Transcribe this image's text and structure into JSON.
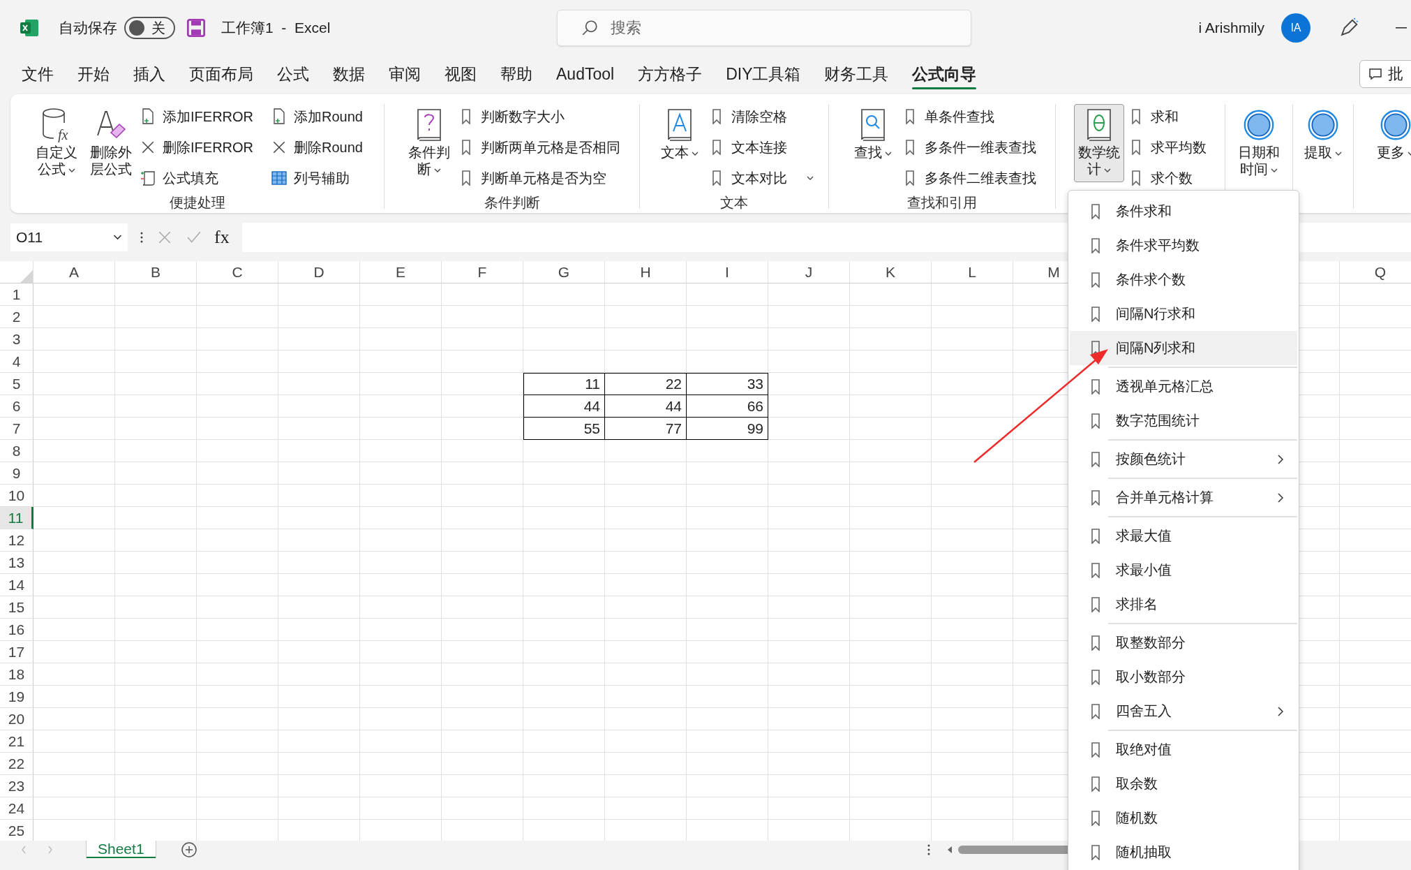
{
  "title_bar": {
    "autosave_label": "自动保存",
    "autosave": {
      "on": false,
      "label": "关"
    },
    "title": "工作簿1  -  Excel",
    "search": {
      "placeholder": "搜索"
    },
    "user_name": "i Arishmily",
    "avatar": "IA"
  },
  "tabs": [
    {
      "label": "文件",
      "selected": false
    },
    {
      "label": "开始",
      "selected": false
    },
    {
      "label": "插入",
      "selected": false
    },
    {
      "label": "页面布局",
      "selected": false
    },
    {
      "label": "公式",
      "selected": false
    },
    {
      "label": "数据",
      "selected": false
    },
    {
      "label": "审阅",
      "selected": false
    },
    {
      "label": "视图",
      "selected": false
    },
    {
      "label": "帮助",
      "selected": false
    },
    {
      "label": "AudTool",
      "selected": false
    },
    {
      "label": "方方格子",
      "selected": false
    },
    {
      "label": "DIY工具箱",
      "selected": false
    },
    {
      "label": "财务工具",
      "selected": false
    },
    {
      "label": "公式向导",
      "selected": true
    }
  ],
  "comment_button": "批",
  "ribbon": {
    "groups": [
      {
        "label": "便捷处理",
        "large": [
          {
            "label": "自定义公式",
            "dropdown": true,
            "selected": false,
            "icon_text": "fx"
          },
          {
            "label": "删除外层公式",
            "dropdown": false,
            "selected": false
          }
        ],
        "small": [
          {
            "label": "添加IFERROR",
            "dropdown": false
          },
          {
            "label": "删除IFERROR",
            "dropdown": false
          },
          {
            "label": "公式填充",
            "dropdown": false
          },
          {
            "label": "添加Round",
            "dropdown": false
          },
          {
            "label": "删除Round",
            "dropdown": false
          },
          {
            "label": "列号辅助",
            "dropdown": false
          }
        ]
      },
      {
        "label": "条件判断",
        "large": [
          {
            "label": "条件判断",
            "dropdown": true,
            "selected": false
          }
        ],
        "small": [
          {
            "label": "判断数字大小",
            "dropdown": false
          },
          {
            "label": "判断两单元格是否相同",
            "dropdown": false
          },
          {
            "label": "判断单元格是否为空",
            "dropdown": false
          }
        ]
      },
      {
        "label": "文本",
        "large": [
          {
            "label": "文本",
            "dropdown": true,
            "selected": false
          }
        ],
        "small": [
          {
            "label": "清除空格",
            "dropdown": false
          },
          {
            "label": "文本连接",
            "dropdown": false
          },
          {
            "label": "文本对比",
            "dropdown": true
          }
        ]
      },
      {
        "label": "查找和引用",
        "large": [
          {
            "label": "查找",
            "dropdown": true,
            "selected": false
          }
        ],
        "small": [
          {
            "label": "单条件查找",
            "dropdown": false
          },
          {
            "label": "多条件一维表查找",
            "dropdown": false
          },
          {
            "label": "多条件二维表查找",
            "dropdown": false
          }
        ]
      },
      {
        "large": [
          {
            "label": "数学统计",
            "dropdown": true,
            "selected": true
          }
        ],
        "small": [
          {
            "label": "求和",
            "dropdown": false
          },
          {
            "label": "求平均数",
            "dropdown": false
          },
          {
            "label": "求个数",
            "dropdown": false
          }
        ]
      },
      {
        "large": [
          {
            "label": "日期和时间",
            "dropdown": true,
            "selected": false
          }
        ]
      },
      {
        "large": [
          {
            "label": "提取",
            "dropdown": true,
            "selected": false
          }
        ]
      },
      {
        "large": [
          {
            "label": "更多",
            "dropdown": true,
            "selected": false
          }
        ]
      }
    ]
  },
  "formula_bar": {
    "name_box": "O11",
    "function_label": "fx"
  },
  "sheet": {
    "columns": [
      "A",
      "B",
      "C",
      "D",
      "E",
      "F",
      "G",
      "H",
      "I",
      "J",
      "K",
      "L",
      "M"
    ],
    "right_columns": [
      "Q"
    ],
    "rows": [
      {
        "label": "1",
        "selected": false
      },
      {
        "label": "2",
        "selected": false
      },
      {
        "label": "3",
        "selected": false
      },
      {
        "label": "4",
        "selected": false
      },
      {
        "label": "5",
        "selected": false
      },
      {
        "label": "6",
        "selected": false
      },
      {
        "label": "7",
        "selected": false
      },
      {
        "label": "8",
        "selected": false
      },
      {
        "label": "9",
        "selected": false
      },
      {
        "label": "10",
        "selected": false
      },
      {
        "label": "11",
        "selected": true
      },
      {
        "label": "12",
        "selected": false
      },
      {
        "label": "13",
        "selected": false
      },
      {
        "label": "14",
        "selected": false
      },
      {
        "label": "15",
        "selected": false
      },
      {
        "label": "16",
        "selected": false
      },
      {
        "label": "17",
        "selected": false
      },
      {
        "label": "18",
        "selected": false
      },
      {
        "label": "19",
        "selected": false
      },
      {
        "label": "20",
        "selected": false
      },
      {
        "label": "21",
        "selected": false
      },
      {
        "label": "22",
        "selected": false
      },
      {
        "label": "23",
        "selected": false
      },
      {
        "label": "24",
        "selected": false
      },
      {
        "label": "25",
        "selected": false
      }
    ],
    "table": [
      [
        "11",
        "22",
        "33"
      ],
      [
        "44",
        "44",
        "66"
      ],
      [
        "55",
        "77",
        "99"
      ]
    ]
  },
  "sheet_tabs": [
    {
      "label": "Sheet1",
      "selected": true
    }
  ],
  "menu": {
    "sections": [
      {
        "items": [
          {
            "label": "条件求和",
            "selected": false,
            "submenu": false
          },
          {
            "label": "条件求平均数",
            "selected": false,
            "submenu": false
          },
          {
            "label": "条件求个数",
            "selected": false,
            "submenu": false
          },
          {
            "label": "间隔N行求和",
            "selected": false,
            "submenu": false
          },
          {
            "label": "间隔N列求和",
            "selected": true,
            "submenu": false
          }
        ]
      },
      {
        "items": [
          {
            "label": "透视单元格汇总",
            "selected": false,
            "submenu": false
          },
          {
            "label": "数字范围统计",
            "selected": false,
            "submenu": false
          }
        ]
      },
      {
        "items": [
          {
            "label": "按颜色统计",
            "selected": false,
            "submenu": true
          }
        ]
      },
      {
        "items": [
          {
            "label": "合并单元格计算",
            "selected": false,
            "submenu": true
          }
        ]
      },
      {
        "items": [
          {
            "label": "求最大值",
            "selected": false,
            "submenu": false
          },
          {
            "label": "求最小值",
            "selected": false,
            "submenu": false
          },
          {
            "label": "求排名",
            "selected": false,
            "submenu": false
          }
        ]
      },
      {
        "items": [
          {
            "label": "取整数部分",
            "selected": false,
            "submenu": false
          },
          {
            "label": "取小数部分",
            "selected": false,
            "submenu": false
          },
          {
            "label": "四舍五入",
            "selected": false,
            "submenu": true
          }
        ]
      },
      {
        "items": [
          {
            "label": "取绝对值",
            "selected": false,
            "submenu": false
          },
          {
            "label": "取余数",
            "selected": false,
            "submenu": false
          },
          {
            "label": "随机数",
            "selected": false,
            "submenu": false
          },
          {
            "label": "随机抽取",
            "selected": false,
            "submenu": false
          }
        ]
      }
    ]
  }
}
